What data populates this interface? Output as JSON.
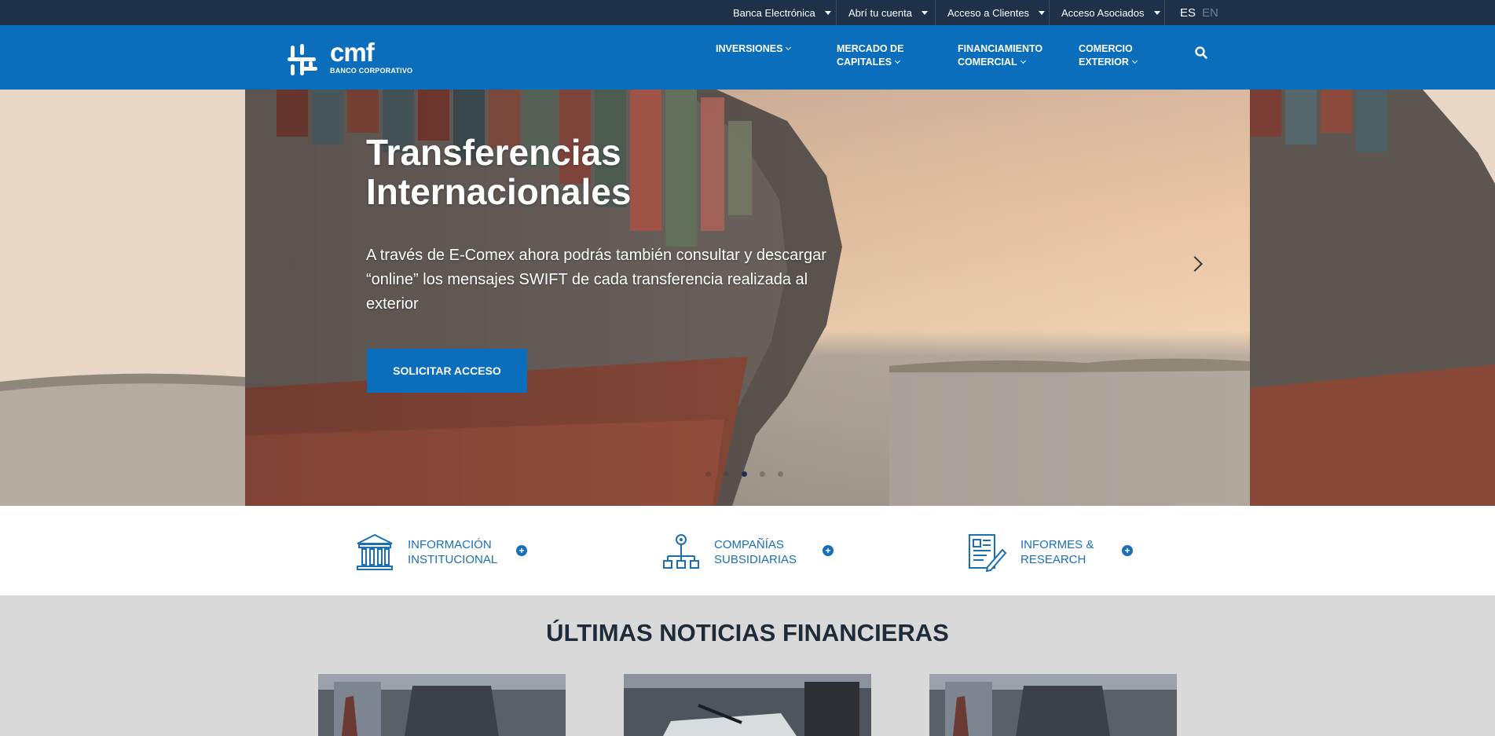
{
  "topbar": {
    "items": [
      {
        "label": "Banca Electrónica"
      },
      {
        "label": "Abrí tu cuenta"
      },
      {
        "label": "Acceso a Clientes"
      },
      {
        "label": "Acceso Asociados"
      }
    ],
    "lang_active": "ES",
    "lang_other": "EN"
  },
  "brand": {
    "name": "cmf",
    "subtitle": "BANCO CORPORATIVO"
  },
  "nav": {
    "items": [
      {
        "line1": "INVERSIONES",
        "line2": ""
      },
      {
        "line1": "MERCADO DE",
        "line2": "CAPITALES"
      },
      {
        "line1": "FINANCIAMIENTO",
        "line2": "COMERCIAL"
      },
      {
        "line1": "COMERCIO",
        "line2": "EXTERIOR"
      }
    ]
  },
  "hero": {
    "title": "Transferencias Internacionales",
    "text": "A través de E-Comex ahora podrás también consultar y descargar “online” los mensajes SWIFT de cada transferencia realizada al exterior",
    "button": "SOLICITAR ACCESO",
    "slide_count": 5,
    "active_slide": 3
  },
  "features": [
    {
      "line1": "INFORMACIÓN",
      "line2": "INSTITUCIONAL",
      "icon": "bank-icon"
    },
    {
      "line1": "COMPAÑÍAS",
      "line2": "SUBSIDIARIAS",
      "icon": "org-chart-icon"
    },
    {
      "line1": "INFORMES &",
      "line2": "RESEARCH",
      "icon": "report-icon"
    }
  ],
  "news": {
    "title": "ÚLTIMAS NOTICIAS FINANCIERAS"
  },
  "colors": {
    "topbar": "#1f3149",
    "brand_blue": "#0a6ebd",
    "link_blue": "#1a6fb7",
    "news_bg": "#d9d9d9"
  }
}
